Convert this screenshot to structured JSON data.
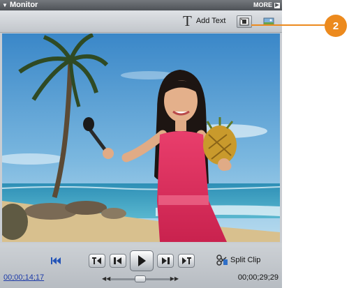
{
  "window": {
    "title": "Monitor",
    "more_label": "MORE",
    "more_icon": "play-right-icon"
  },
  "toolbar": {
    "add_text_label": "Add Text",
    "add_text_icon": "text-t-icon",
    "safe_margins_icon": "safe-margins-icon",
    "clip_view_icon": "clip-view-icon"
  },
  "controls": {
    "go_to_start_icon": "go-to-start-icon",
    "buttons": [
      "go-to-previous-edit-icon",
      "step-back-icon",
      "play-icon",
      "step-forward-icon",
      "go-to-next-edit-icon"
    ],
    "split_clip_label": "Split Clip",
    "split_clip_icon": "split-clip-icon",
    "current_time": "00;00;14;17",
    "duration": "00;00;29;29"
  },
  "callout": {
    "number": "2"
  },
  "colors": {
    "accent_callout": "#ec8a1e",
    "timecode_link": "#1c3aa8",
    "title_bar": "#5a5e63",
    "panel_bg": "#c9cdd2"
  }
}
